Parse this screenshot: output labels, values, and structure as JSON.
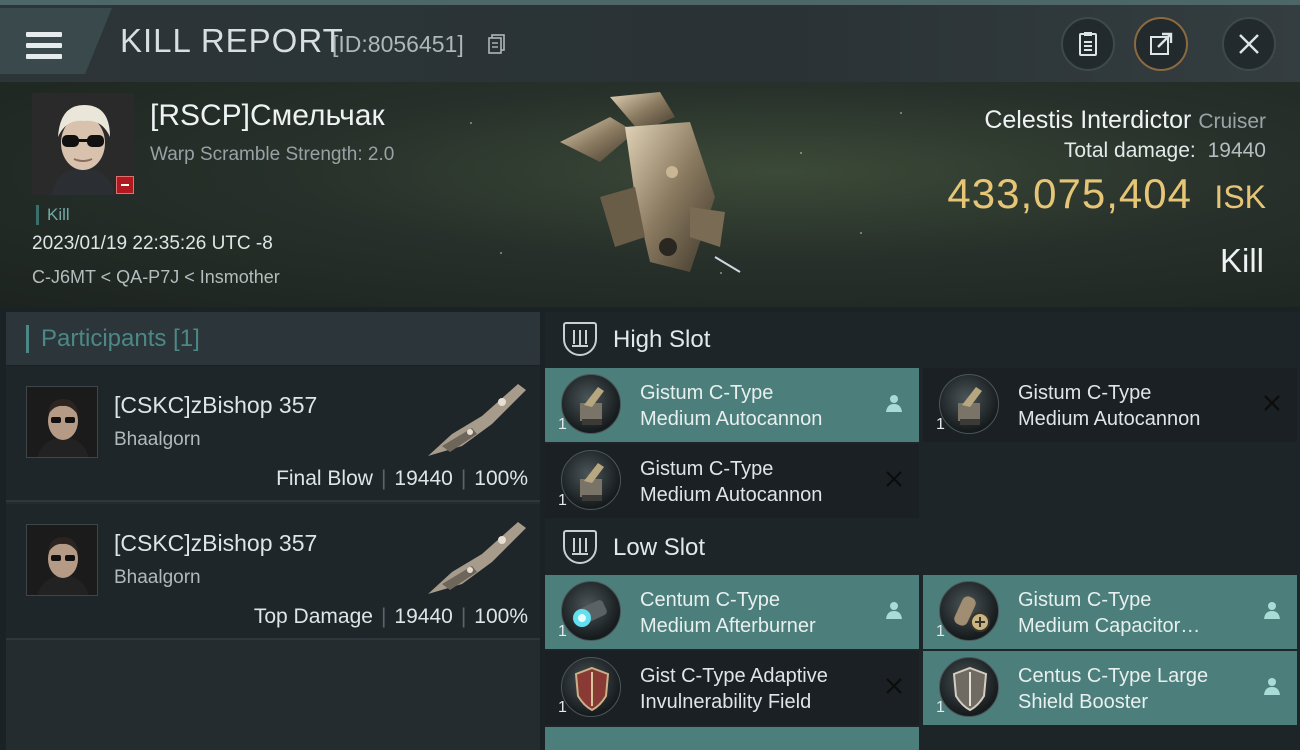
{
  "header": {
    "title": "KILL REPORT",
    "id_label": "[ID:8056451]"
  },
  "victim": {
    "name": "[RSCP]Смельчак",
    "warp_scramble": "Warp Scramble Strength: 2.0",
    "kill_tag": "Kill",
    "datetime": "2023/01/19 22:35:26 UTC -8",
    "route": "C-J6MT < QA-P7J < Insmother",
    "ship_name": "Celestis Interdictor",
    "ship_class": "Cruiser",
    "total_damage_label": "Total damage:",
    "total_damage": "19440",
    "isk_value": "433,075,404",
    "isk_unit": "ISK",
    "result": "Kill"
  },
  "participants": {
    "title": "Participants [1]",
    "rows": [
      {
        "name": "[CSKC]zBishop 357",
        "ship": "Bhaalgorn",
        "role": "Final Blow",
        "damage": "19440",
        "percent": "100%"
      },
      {
        "name": "[CSKC]zBishop 357",
        "ship": "Bhaalgorn",
        "role": "Top Damage",
        "damage": "19440",
        "percent": "100%"
      }
    ]
  },
  "fitting": {
    "high_slot": {
      "label": "High Slot",
      "modules": [
        {
          "line1": "Gistum C-Type",
          "line2": "Medium Autocannon",
          "qty": "1",
          "status": "person-icon",
          "highlight": true
        },
        {
          "line1": "Gistum C-Type",
          "line2": "Medium Autocannon",
          "qty": "1",
          "status": "close-icon",
          "highlight": false
        },
        {
          "line1": "Gistum C-Type",
          "line2": "Medium Autocannon",
          "qty": "1",
          "status": "close-icon",
          "highlight": false
        }
      ]
    },
    "low_slot": {
      "label": "Low Slot",
      "modules": [
        {
          "line1": "Centum C-Type",
          "line2": "Medium Afterburner",
          "qty": "1",
          "status": "person-icon",
          "highlight": true
        },
        {
          "line1": "Gistum C-Type",
          "line2": "Medium Capacitor…",
          "qty": "1",
          "status": "person-icon",
          "highlight": true
        },
        {
          "line1": "Gist C-Type Adaptive",
          "line2": "Invulnerability Field",
          "qty": "1",
          "status": "close-icon",
          "highlight": false
        },
        {
          "line1": "Centus C-Type Large",
          "line2": "Shield Booster",
          "qty": "1",
          "status": "person-icon",
          "highlight": true
        }
      ]
    }
  },
  "colors": {
    "accent_teal": "#4c7f7b",
    "isk_gold": "#e6c577",
    "background": "#1b2226"
  }
}
